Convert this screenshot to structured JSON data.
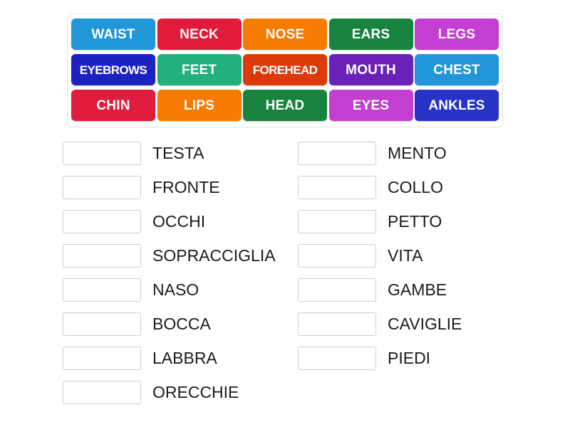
{
  "activity": {
    "type": "match-up",
    "language_pair": "English to Italian",
    "tile_bank": {
      "rows": [
        [
          {
            "label": "WAIST",
            "color": "#2196d9",
            "fit": "normal"
          },
          {
            "label": "NECK",
            "color": "#e01b3c",
            "fit": "normal"
          },
          {
            "label": "NOSE",
            "color": "#f57c00",
            "fit": "normal"
          },
          {
            "label": "EARS",
            "color": "#17833f",
            "fit": "normal"
          },
          {
            "label": "LEGS",
            "color": "#c43fd1",
            "fit": "normal"
          }
        ],
        [
          {
            "label": "EYEBROWS",
            "color": "#1d21c2",
            "fit": "shrink-2"
          },
          {
            "label": "FEET",
            "color": "#22b07c",
            "fit": "normal"
          },
          {
            "label": "FOREHEAD",
            "color": "#dd3a0b",
            "fit": "shrink-2"
          },
          {
            "label": "MOUTH",
            "color": "#6a21b8",
            "fit": "normal"
          },
          {
            "label": "CHEST",
            "color": "#2196d9",
            "fit": "normal"
          }
        ],
        [
          {
            "label": "CHIN",
            "color": "#e01b3c",
            "fit": "normal"
          },
          {
            "label": "LIPS",
            "color": "#f57c00",
            "fit": "normal"
          },
          {
            "label": "HEAD",
            "color": "#17833f",
            "fit": "normal"
          },
          {
            "label": "EYES",
            "color": "#c43fd1",
            "fit": "normal"
          },
          {
            "label": "ANKLES",
            "color": "#2632c8",
            "fit": "normal"
          }
        ]
      ]
    },
    "answers": {
      "left_column": [
        {
          "drop_value": "",
          "label": "TESTA"
        },
        {
          "drop_value": "",
          "label": "FRONTE"
        },
        {
          "drop_value": "",
          "label": "OCCHI"
        },
        {
          "drop_value": "",
          "label": "SOPRACCIGLIA"
        },
        {
          "drop_value": "",
          "label": "NASO"
        },
        {
          "drop_value": "",
          "label": "BOCCA"
        },
        {
          "drop_value": "",
          "label": "LABBRA"
        },
        {
          "drop_value": "",
          "label": "ORECCHIE"
        }
      ],
      "right_column": [
        {
          "drop_value": "",
          "label": "MENTO"
        },
        {
          "drop_value": "",
          "label": "COLLO"
        },
        {
          "drop_value": "",
          "label": "PETTO"
        },
        {
          "drop_value": "",
          "label": "VITA"
        },
        {
          "drop_value": "",
          "label": "GAMBE"
        },
        {
          "drop_value": "",
          "label": "CAVIGLIE"
        },
        {
          "drop_value": "",
          "label": "PIEDI"
        }
      ]
    }
  }
}
